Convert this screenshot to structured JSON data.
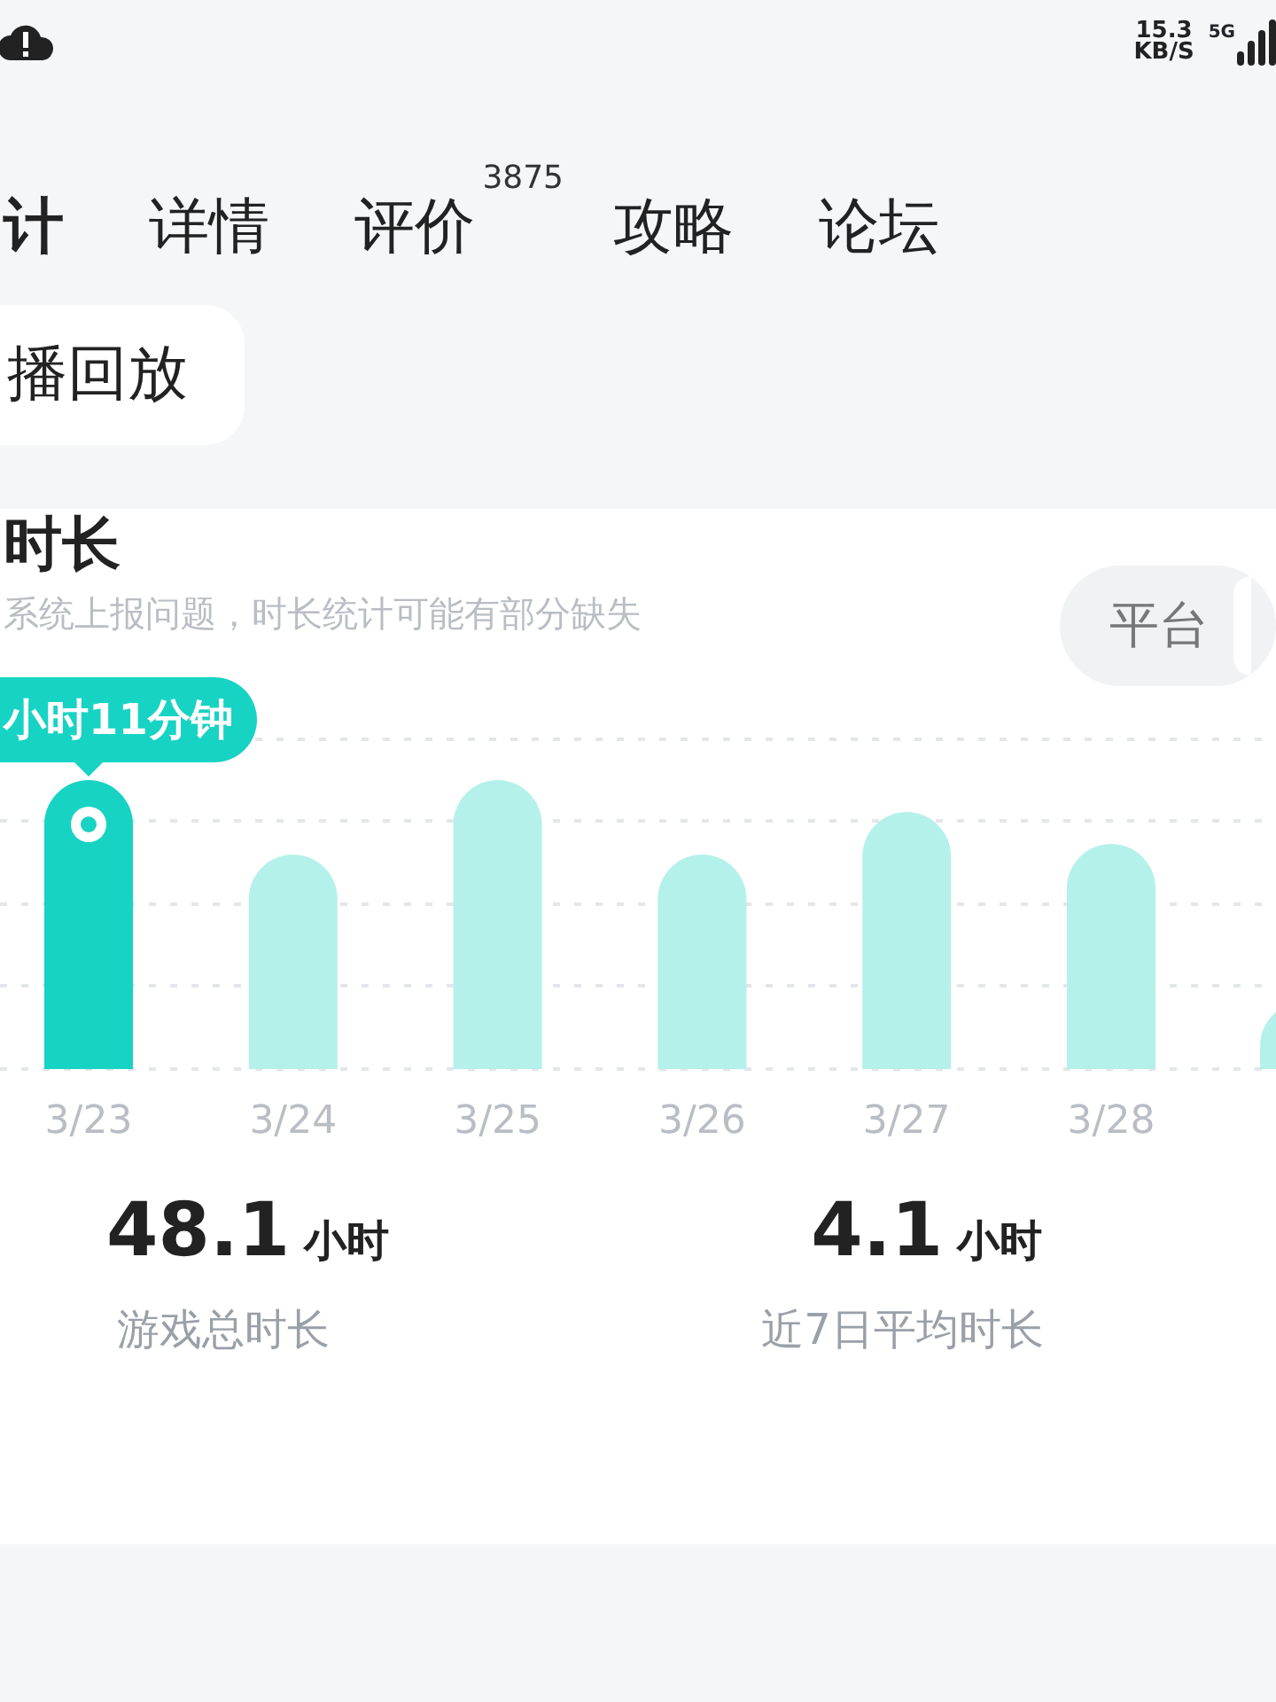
{
  "status_bar": {
    "network_speed": "15.3",
    "network_unit": "KB/S",
    "signal_type": "5G"
  },
  "tabs": [
    {
      "label": "计",
      "selected": true
    },
    {
      "label": "详情",
      "selected": false
    },
    {
      "label": "评价",
      "selected": false,
      "badge": "3875"
    },
    {
      "label": "攻略",
      "selected": false
    },
    {
      "label": "论坛",
      "selected": false
    }
  ],
  "chip": {
    "label": "播回放"
  },
  "card": {
    "title": "时长",
    "subtitle": "系统上报问题，时长统计可能有部分缺失",
    "toggle": {
      "label": "平台"
    },
    "chart": {
      "tooltip": "小时11分钟",
      "bars": [
        {
          "label": "3/23",
          "selected": true
        },
        {
          "label": "3/24",
          "selected": false
        },
        {
          "label": "3/25",
          "selected": false
        },
        {
          "label": "3/26",
          "selected": false
        },
        {
          "label": "3/27",
          "selected": false
        },
        {
          "label": "3/28",
          "selected": false
        }
      ]
    },
    "stats": [
      {
        "value": "48.1",
        "unit": "小时",
        "label": "游戏总时长"
      },
      {
        "value": "4.1",
        "unit": "小时",
        "label": "近7日平均时长"
      }
    ]
  }
}
